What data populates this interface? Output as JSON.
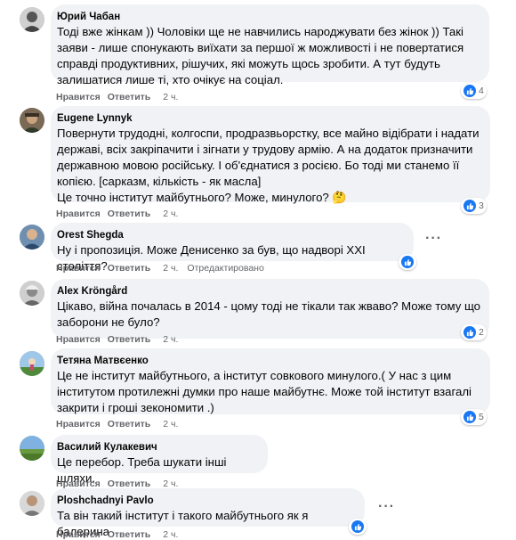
{
  "comments": [
    {
      "author": "Юрий Чабан",
      "text": "Тоді вже жінкам )) Чоловіки ще не навчились народжувати без жінок )) Такі заяви - лише спонукають виїхати за першої ж можливості і не повертатися справді продуктивних, рішучих, які можуть щось зробити. А тут будуть залишатися лише ті, хто очікує на соціал.",
      "like": "Нравится",
      "reply": "Ответить",
      "time": "2 ч.",
      "reactions": "4"
    },
    {
      "author": "Eugene Lynnyk",
      "text": "Повернути трудодні, колгоспи, продразвьорстку, все майно відібрати і надати державі, всіх закріпачити і зігнати у трудову армію. А на додаток призначити державною мовою російську. І об'єднатися з росією. Бо тоді ми станемо її копією. [сарказм, кількість - як масла]",
      "text2": "Це точно інститут майбутнього? Може, минулого?",
      "emoji": "🤔",
      "like": "Нравится",
      "reply": "Ответить",
      "time": "2 ч.",
      "reactions": "3"
    },
    {
      "author": "Orest Shegda",
      "text": "Ну і пропозиція. Може Денисенко за був, що надворі XXI століття?",
      "like": "Нравится",
      "reply": "Ответить",
      "time": "2 ч.",
      "edited": "Отредактировано",
      "reactions": ""
    },
    {
      "author": "Alex Kröngård",
      "text": "Цікаво, війна почалась в 2014 - цому тоді не тікали так жваво? Може тому що заборони не було?",
      "like": "Нравится",
      "reply": "Ответить",
      "time": "2 ч.",
      "reactions": "2"
    },
    {
      "author": "Тетяна Матвєенко",
      "text": "Це не інститут майбутнього, а інститут совкового минулого.( У нас з цим інститутом протилежні думки про наше майбутнє. Може той інститут взагалі закрити і гроші зекономити .)",
      "like": "Нравится",
      "reply": "Ответить",
      "time": "2 ч.",
      "reactions": "5"
    },
    {
      "author": "Василий Кулакевич",
      "text": "Це перебор. Треба шукати інші шляхи.",
      "like": "Нравится",
      "reply": "Ответить",
      "time": "2 ч.",
      "reactions": ""
    },
    {
      "author": "Ploshchadnyi Pavlo",
      "text": "Та він такий інститут і такого майбутнього як я балерина",
      "like": "Нравится",
      "reply": "Ответить",
      "time": "2 ч.",
      "reactions": ""
    }
  ],
  "colors": {
    "bubble": "#f0f2f5",
    "like_blue": "#1877f2",
    "meta_gray": "#65676b"
  },
  "icons": {
    "reaction": "thumbs-up-icon",
    "more": "more-dots-icon"
  }
}
